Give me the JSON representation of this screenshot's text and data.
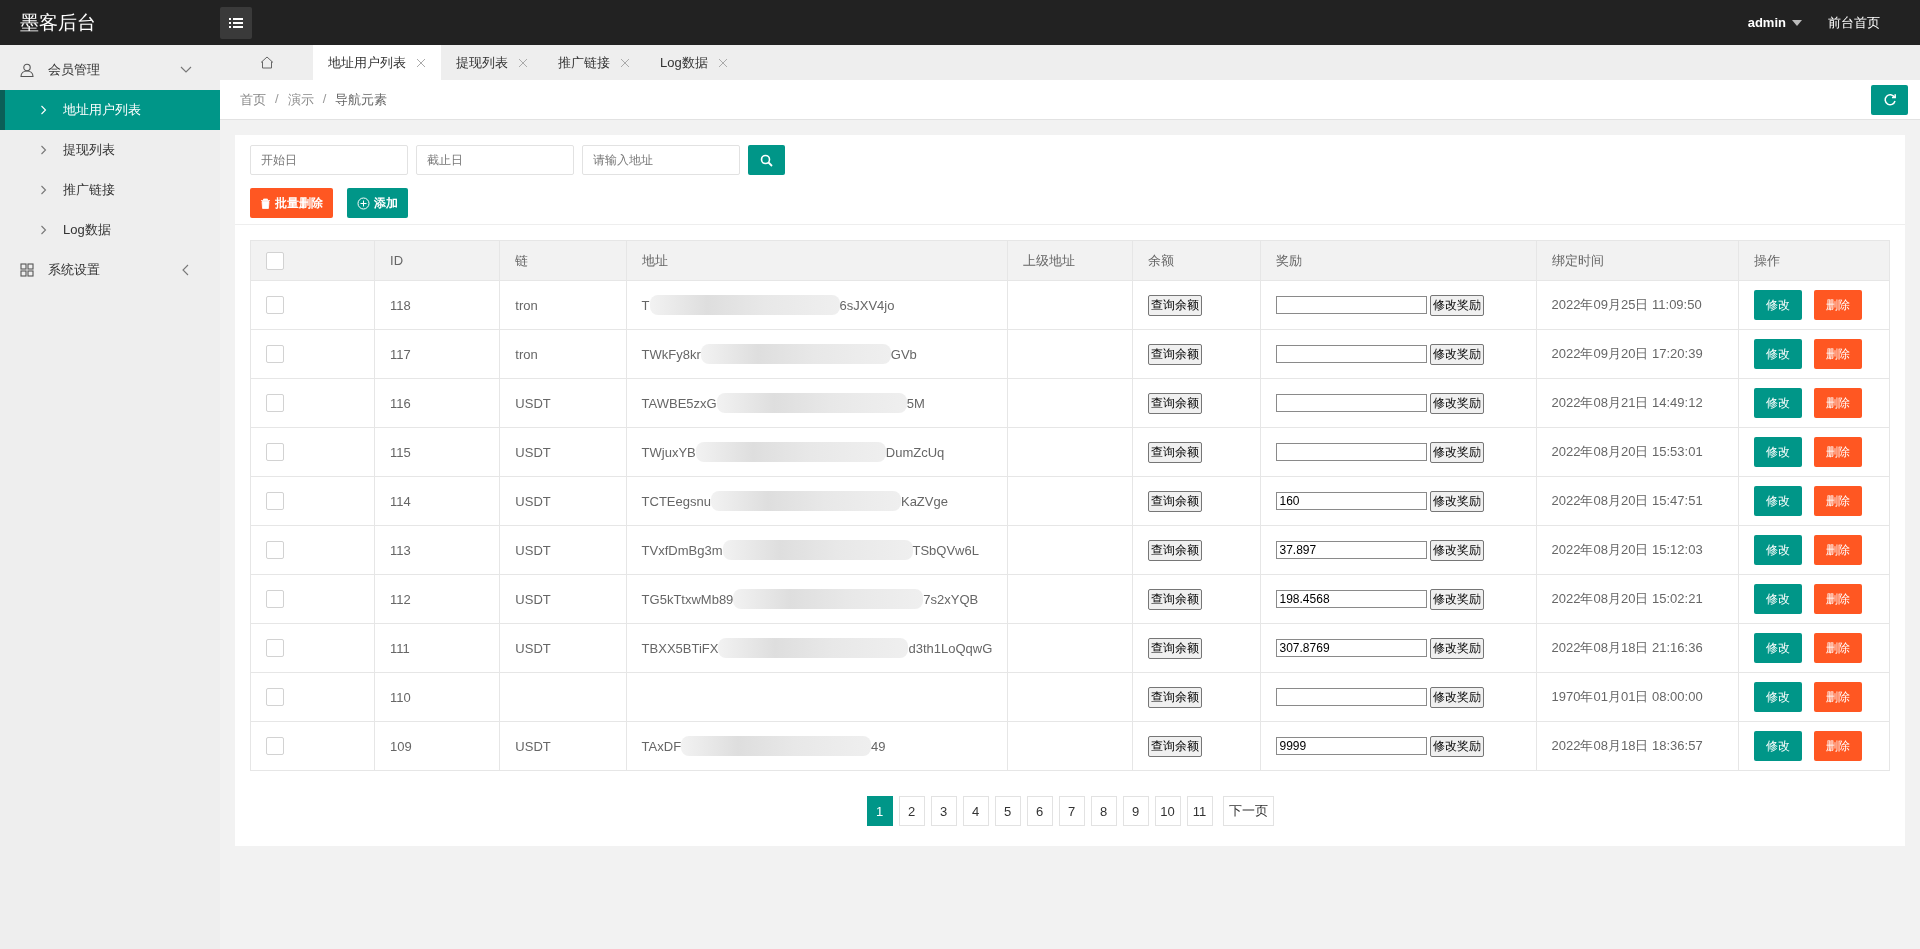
{
  "header": {
    "logo": "墨客后台",
    "user": "admin",
    "home_link": "前台首页"
  },
  "sidebar": {
    "groups": [
      {
        "label": "会员管理",
        "expanded": true,
        "children": [
          {
            "label": "地址用户列表",
            "selected": true
          },
          {
            "label": "提现列表",
            "selected": false
          },
          {
            "label": "推广链接",
            "selected": false
          },
          {
            "label": "Log数据",
            "selected": false
          }
        ]
      },
      {
        "label": "系统设置",
        "expanded": false
      }
    ]
  },
  "tabs": [
    {
      "label": "地址用户列表",
      "selected": true
    },
    {
      "label": "提现列表",
      "selected": false
    },
    {
      "label": "推广链接",
      "selected": false
    },
    {
      "label": "Log数据",
      "selected": false
    }
  ],
  "breadcrumb": {
    "items": [
      "首页",
      "演示",
      "导航元素"
    ],
    "separators": [
      "/",
      "/"
    ]
  },
  "filters": {
    "start_placeholder": "开始日",
    "end_placeholder": "截止日",
    "address_placeholder": "请输入地址"
  },
  "actions": {
    "batch_delete": "批量删除",
    "add": "添加"
  },
  "table": {
    "select_all_checked": false,
    "columns": [
      "ID",
      "链",
      "地址",
      "上级地址",
      "余额",
      "奖励",
      "绑定时间",
      "操作"
    ],
    "rows": [
      {
        "checked": false,
        "id": "118",
        "chain": "tron",
        "address_start": "T",
        "address_end": "6sJXV4jo",
        "balance_button": "查询余额",
        "reward": "",
        "reward_button": "修改奖励",
        "time": "2022年09月25日 11:09:50",
        "edit_button": "修改",
        "delete_button": "删除"
      },
      {
        "checked": false,
        "id": "117",
        "chain": "tron",
        "address_start": "TWkFy8kr",
        "address_end": "GVb",
        "balance_button": "查询余额",
        "reward": "",
        "reward_button": "修改奖励",
        "time": "2022年09月20日 17:20:39",
        "edit_button": "修改",
        "delete_button": "删除"
      },
      {
        "checked": false,
        "id": "116",
        "chain": "USDT",
        "address_start": "TAWBE5zxG",
        "address_end": "5M",
        "balance_button": "查询余额",
        "reward": "",
        "reward_button": "修改奖励",
        "time": "2022年08月21日 14:49:12",
        "edit_button": "修改",
        "delete_button": "删除"
      },
      {
        "checked": false,
        "id": "115",
        "chain": "USDT",
        "address_start": "TWjuxYB",
        "address_end": "DumZcUq",
        "balance_button": "查询余额",
        "reward": "",
        "reward_button": "修改奖励",
        "time": "2022年08月20日 15:53:01",
        "edit_button": "修改",
        "delete_button": "删除"
      },
      {
        "checked": false,
        "id": "114",
        "chain": "USDT",
        "address_start": "TCTEegsnu",
        "address_end": "KaZVge",
        "balance_button": "查询余额",
        "reward": "160",
        "reward_button": "修改奖励",
        "time": "2022年08月20日 15:47:51",
        "edit_button": "修改",
        "delete_button": "删除"
      },
      {
        "checked": false,
        "id": "113",
        "chain": "USDT",
        "address_start": "TVxfDmBg3m",
        "address_end": "TSbQVw6L",
        "balance_button": "查询余额",
        "reward": "37.897",
        "reward_button": "修改奖励",
        "time": "2022年08月20日 15:12:03",
        "edit_button": "修改",
        "delete_button": "删除"
      },
      {
        "checked": false,
        "id": "112",
        "chain": "USDT",
        "address_start": "TG5kTtxwMb89",
        "address_end": "7s2xYQB",
        "balance_button": "查询余额",
        "reward": "198.4568",
        "reward_button": "修改奖励",
        "time": "2022年08月20日 15:02:21",
        "edit_button": "修改",
        "delete_button": "删除"
      },
      {
        "checked": false,
        "id": "111",
        "chain": "USDT",
        "address_start": "TBXX5BTiFX",
        "address_end": "d3th1LoQqwG",
        "balance_button": "查询余额",
        "reward": "307.8769",
        "reward_button": "修改奖励",
        "time": "2022年08月18日 21:16:36",
        "edit_button": "修改",
        "delete_button": "删除"
      },
      {
        "checked": false,
        "id": "110",
        "balance_button": "查询余额",
        "reward": "",
        "reward_button": "修改奖励",
        "time": "1970年01月01日 08:00:00",
        "edit_button": "修改",
        "delete_button": "删除"
      },
      {
        "checked": false,
        "id": "109",
        "chain": "USDT",
        "address_start": "TAxDF",
        "address_end": "49",
        "balance_button": "查询余额",
        "reward": "9999",
        "reward_button": "修改奖励",
        "time": "2022年08月18日 18:36:57",
        "edit_button": "修改",
        "delete_button": "删除"
      }
    ]
  },
  "pagination": {
    "pages": [
      {
        "label": "1",
        "selected": true
      },
      {
        "label": "2",
        "selected": false
      },
      {
        "label": "3",
        "selected": false
      },
      {
        "label": "4",
        "selected": false
      },
      {
        "label": "5",
        "selected": false
      },
      {
        "label": "6",
        "selected": false
      },
      {
        "label": "7",
        "selected": false
      },
      {
        "label": "8",
        "selected": false
      },
      {
        "label": "9",
        "selected": false
      },
      {
        "label": "10",
        "selected": false
      },
      {
        "label": "11",
        "selected": false
      }
    ],
    "next": "下一页"
  }
}
